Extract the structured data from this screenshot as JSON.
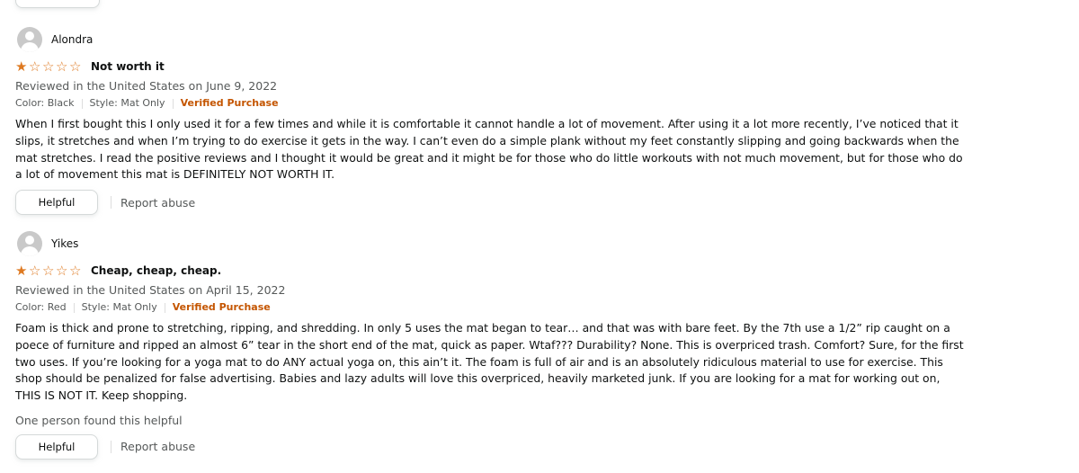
{
  "colors": {
    "star": "#de7921",
    "verified": "#c45500",
    "muted": "#565959",
    "text": "#0f1111"
  },
  "reviews": [
    {
      "profile_name": "Alondra",
      "rating": 1,
      "title": "Not worth it",
      "date_line": "Reviewed in the United States on June 9, 2022",
      "color": "Color: Black",
      "style": "Style: Mat Only",
      "verified": "Verified Purchase",
      "body": "When I first bought this I only used it for a few times and while it is comfortable it cannot handle a lot of movement. After using it a lot more recently, I’ve noticed that it slips, it stretches and when I’m trying to do exercise it gets in the way. I can’t even do a simple plank without my feet constantly slipping and going backwards when the mat stretches. I read the positive reviews and I thought it would be great and it might be for those who do little workouts with not much movement, but for those who do a lot of movement this mat is DEFINITELY NOT WORTH IT.",
      "helpful_label": "Helpful",
      "report_label": "Report abuse"
    },
    {
      "profile_name": "Yikes",
      "rating": 1,
      "title": "Cheap, cheap, cheap.",
      "date_line": "Reviewed in the United States on April 15, 2022",
      "color": "Color: Red",
      "style": "Style: Mat Only",
      "verified": "Verified Purchase",
      "body": "Foam is thick and prone to stretching, ripping, and shredding. In only 5 uses the mat began to tear… and that was with bare feet. By the 7th use a 1/2” rip caught on a poece of furniture and ripped an almost 6” tear in the short end of the mat, quick as paper. Wtaf??? Durability? None. This is overpriced trash. Comfort? Sure, for the first two uses. If you’re looking for a yoga mat to do ANY actual yoga on, this ain’t it. The foam is full of air and is an absolutely ridiculous material to use for exercise. This shop should be penalized for false advertising. Babies and lazy adults will love this overpriced, heavily marketed junk. If you are looking for a mat for working out on, THIS IS NOT IT. Keep shopping.",
      "helpful_count": "One person found this helpful",
      "helpful_label": "Helpful",
      "report_label": "Report abuse"
    }
  ]
}
